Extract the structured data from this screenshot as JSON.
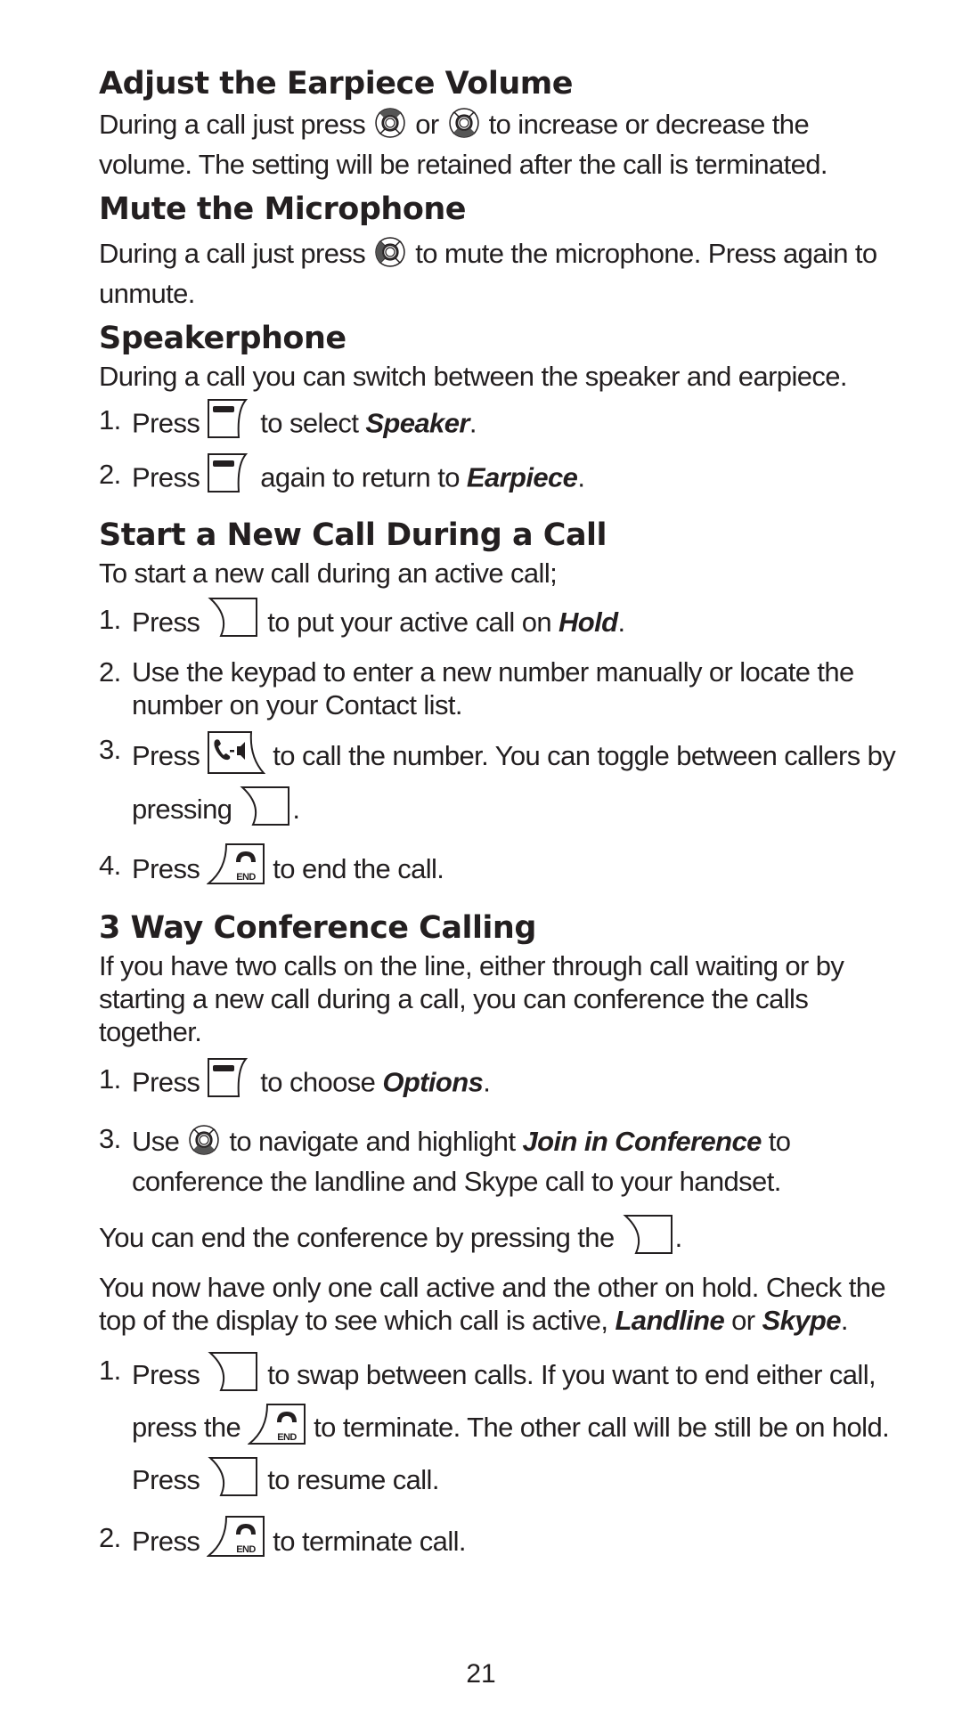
{
  "page_number": "21",
  "sections": {
    "earpiece": {
      "title": "Adjust the Earpiece Volume",
      "p1_a": "During a call just press",
      "p1_or": "or",
      "p1_b": "to increase or decrease the",
      "p1_c": "volume. The setting will be retained after the call is terminated."
    },
    "mute": {
      "title": "Mute the Microphone",
      "p1_a": "During a call just press",
      "p1_b": "to mute the microphone. Press again",
      "p1_c": "to unmute."
    },
    "speaker": {
      "title": "Speakerphone",
      "intro": "During a call you can switch between the speaker and earpiece.",
      "steps": [
        {
          "num": "1.",
          "a": "Press",
          "b": "to select",
          "em": "Speaker",
          "end": "."
        },
        {
          "num": "2.",
          "a": "Press",
          "b": "again to return to",
          "em": "Earpiece",
          "end": "."
        }
      ]
    },
    "newcall": {
      "title": "Start a New Call During a Call",
      "intro": "To start a new call during an active call;",
      "steps": [
        {
          "num": "1.",
          "a": "Press",
          "b": "to put your active call on",
          "em": "Hold",
          "end": "."
        },
        {
          "num": "2.",
          "a": "Use the keypad to enter a new number manually or locate the number on your Contact list."
        },
        {
          "num": "3.",
          "a": "Press",
          "b": "to call the number. You can toggle between callers by pressing",
          "end": "."
        },
        {
          "num": "4.",
          "a": "Press",
          "b": "to end the call."
        }
      ]
    },
    "conference": {
      "title": "3 Way Conference Calling",
      "intro": "If you have two calls on the line, either through call waiting or by starting a new call during a call, you can conference the calls together.",
      "steps": [
        {
          "num": "1.",
          "a": "Press",
          "b": "to choose",
          "em": "Options",
          "end": "."
        },
        {
          "num": "3.",
          "a": "Use",
          "b": "to navigate and highlight",
          "em": "Join in Conference",
          "c": "to conference the landline and Skype call to your handset."
        }
      ],
      "end_a": "You can end the conference by pressing the",
      "end_b": ".",
      "hold_a": "You now have only one call active and the other on hold. Check the top of the display to see which call is active,",
      "hold_em1": "Landline",
      "hold_or": "or",
      "hold_em2": "Skype",
      "hold_end": ".",
      "steps2": [
        {
          "num": "1.",
          "a": "Press",
          "b": "to swap between calls.  If you want to end either call, press the",
          "c": "to terminate. The other call will be still be on hold. Press",
          "d": "to resume call."
        },
        {
          "num": "2.",
          "a": "Press",
          "b": "to terminate call."
        }
      ]
    }
  },
  "icons": {
    "nav_up": "nav-key-up-highlighted",
    "nav_down": "nav-key-down-highlighted",
    "nav_left": "nav-key-left-highlighted",
    "left_softkey": "left-softkey",
    "right_softkey": "right-softkey",
    "talk_speaker": "talk-speaker-key",
    "end": "end-key"
  }
}
